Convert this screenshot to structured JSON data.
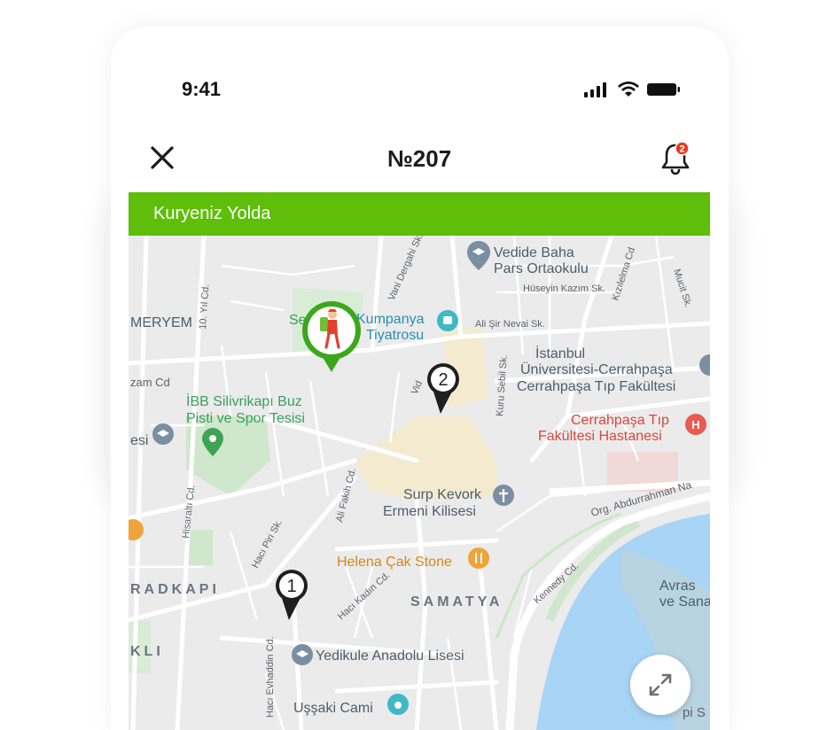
{
  "status_bar": {
    "time": "9:41"
  },
  "header": {
    "title": "№207",
    "notification_count": "2"
  },
  "banner": {
    "text": "Kuryeniz Yolda"
  },
  "map": {
    "labels": {
      "vedide_1": "Vedide Baha",
      "vedide_2": "Pars Ortaokulu",
      "kumpanya_1": "Kumpanya",
      "kumpanya_2": "Tiyatrosu",
      "se": "Se",
      "meryem": "MERYEM",
      "uni_1": "İstanbul",
      "uni_2": "Üniversitesi-Cerrahpaşa",
      "uni_3": "Cerrahpaşa Tıp Fakültesi",
      "ibb_1": "İBB Silivrikapı Buz",
      "ibb_2": "Pisti ve Spor Tesisi",
      "hastane_1": "Cerrahpaşa Tıp",
      "hastane_2": "Fakültesi Hastanesi",
      "surp_1": "Surp Kevork",
      "surp_2": "Ermeni Kilisesi",
      "helena": "Helena Çak Stone",
      "radkapi": "RADKAPI",
      "samatya": "SAMATYA",
      "avras_1": "Avras",
      "avras_2": "ve Sana",
      "kli": "KLI",
      "yedikule": "Yedikule Anadolu Lisesi",
      "ussaki": "Uşşaki Cami",
      "abdurrahman": "Org. Abdurrahman Na",
      "kennedy": "Kennedy Cd.",
      "ali_sir": "Ali Şir Nevai Sk.",
      "huseyin": "Hüseyin Kazım Sk.",
      "kizilelma": "Kızılelma Cd",
      "mucit": "Mucit Sk.",
      "yil": "10. Yıl Cd.",
      "hisaralti": "Hisaraltı Cd.",
      "fakih": "Ali Fakih Cd.",
      "piri": "Hacı Piri Sk.",
      "kadin": "Hacı Kadın Cd.",
      "evhaddin": "Hacı Evhaddin Cd.",
      "kuru": "Kuru Sebil Sk.",
      "zam": "zam Cd",
      "esi": "esi",
      "vani": "Vani Dergahi Sk.",
      "vid": "Vid",
      "pi": "pi S"
    },
    "markers": {
      "stop_1": "1",
      "stop_2": "2"
    }
  },
  "colors": {
    "accent": "#5ebe0a",
    "water": "#a8d4f6",
    "park": "#cbe8c8"
  }
}
